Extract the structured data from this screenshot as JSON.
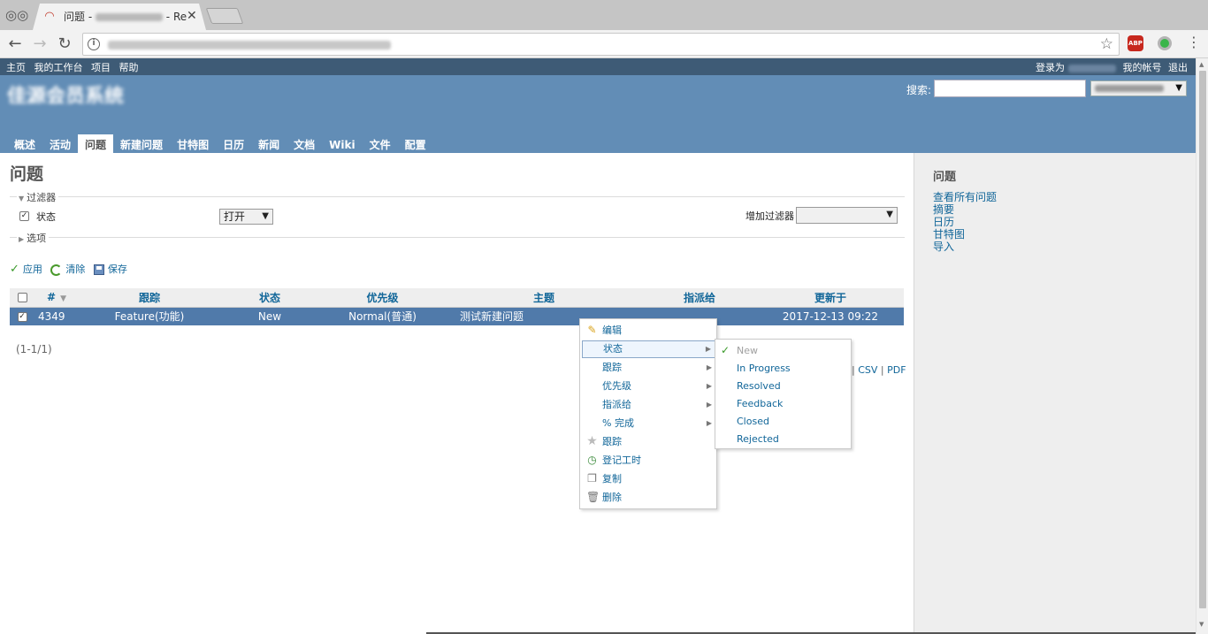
{
  "browser": {
    "tab_title": "问题 - ",
    "tab_title_tail": "- Re",
    "tab_close": "✕"
  },
  "topmenu": {
    "items": [
      "主页",
      "我的工作台",
      "项目",
      "帮助"
    ],
    "logged_in_as": "登录为",
    "my_account": "我的帐号",
    "logout": "退出"
  },
  "header": {
    "project_title": "佳源会员系统",
    "search_label": "搜索:"
  },
  "mainmenu": {
    "items": [
      "概述",
      "活动",
      "问题",
      "新建问题",
      "甘特图",
      "日历",
      "新闻",
      "文档",
      "Wiki",
      "文件",
      "配置"
    ],
    "selected_index": 2
  },
  "page": {
    "title": "问题",
    "filters_legend": "过滤器",
    "status_filter_label": "状态",
    "status_filter_value": "打开",
    "add_filter_label": "增加过滤器",
    "options_legend": "选项",
    "apply": "应用",
    "clear": "清除",
    "save": "保存"
  },
  "table": {
    "columns": [
      "#",
      "跟踪",
      "状态",
      "优先级",
      "主题",
      "指派给",
      "更新于"
    ],
    "rows": [
      {
        "id": "4349",
        "tracker": "Feature(功能)",
        "status": "New",
        "priority": "Normal(普通)",
        "subject": "测试新建问题",
        "assignee": "",
        "updated": "2017-12-13 09:22",
        "selected": true
      }
    ],
    "count": "(1-1/1)",
    "export": {
      "sep1": "|",
      "csv": "CSV",
      "sep2": "|",
      "pdf": "PDF"
    }
  },
  "context_menu": {
    "items": [
      "编辑",
      "状态",
      "跟踪",
      "优先级",
      "指派给",
      "% 完成",
      "跟踪",
      "登记工时",
      "复制",
      "删除"
    ],
    "icons": [
      "pencil-icon",
      "none",
      "none",
      "none",
      "none",
      "none",
      "star-icon",
      "clock-icon",
      "copy-icon",
      "trash-icon"
    ],
    "hover_index": 1
  },
  "status_submenu": {
    "items": [
      "New",
      "In Progress",
      "Resolved",
      "Feedback",
      "Closed",
      "Rejected"
    ],
    "current": "New"
  },
  "sidebar": {
    "title": "问题",
    "links": [
      "查看所有问题",
      "摘要",
      "日历",
      "甘特图",
      "导入"
    ]
  },
  "colors": {
    "topmenu": "#3e5b76",
    "header": "#628db6",
    "link": "#116699",
    "selected_row": "#507aaa",
    "sidebar": "#eeeeee"
  }
}
